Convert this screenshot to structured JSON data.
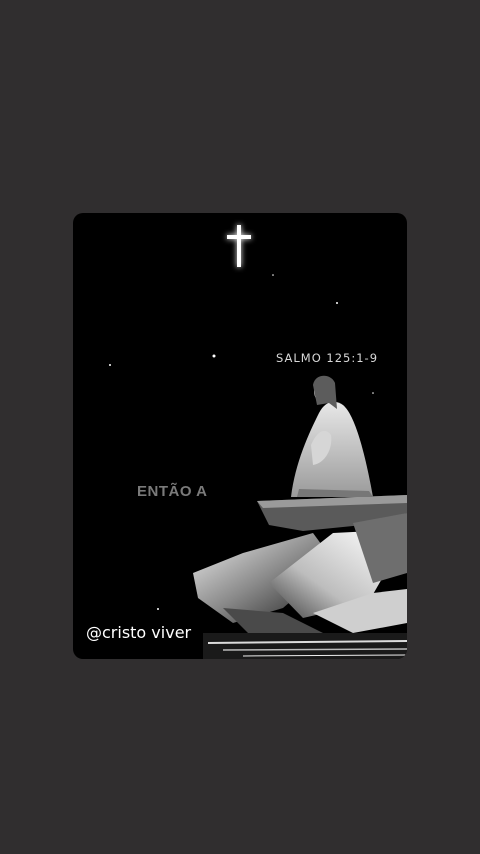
{
  "post": {
    "verse_reference": "SALMO 125:1-9",
    "caption_text": "ENTÃO A",
    "watermark_handle": "@cristo viver"
  },
  "colors": {
    "background": "#302e2f",
    "card": "#000000",
    "cross_glow": "#ffffff",
    "caption": "#7a7a7a"
  },
  "icons": {
    "cross": "glowing-cross-icon"
  }
}
